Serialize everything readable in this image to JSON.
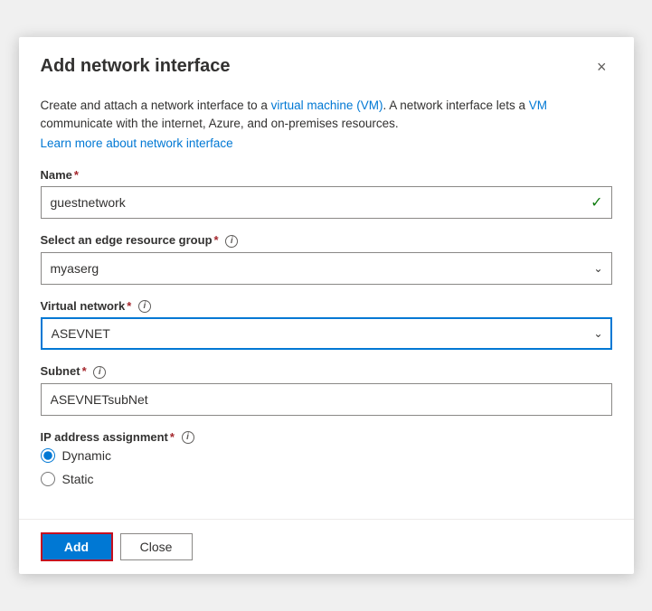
{
  "dialog": {
    "title": "Add network interface",
    "close_label": "×"
  },
  "description": {
    "text1": "Create and attach a network interface to a virtual machine (VM). A network interface lets a VM communicate with the internet, Azure, and on-premises resources.",
    "link_text": "Learn more about network interface"
  },
  "form": {
    "name_label": "Name",
    "name_required": "*",
    "name_value": "guestnetwork",
    "edge_rg_label": "Select an edge resource group",
    "edge_rg_required": "*",
    "edge_rg_value": "myaserg",
    "virtual_network_label": "Virtual network",
    "virtual_network_required": "*",
    "virtual_network_value": "ASEVNET",
    "subnet_label": "Subnet",
    "subnet_required": "*",
    "subnet_value": "ASEVNETsubNet",
    "ip_label": "IP address assignment",
    "ip_required": "*",
    "ip_options": [
      {
        "value": "dynamic",
        "label": "Dynamic",
        "checked": true
      },
      {
        "value": "static",
        "label": "Static",
        "checked": false
      }
    ]
  },
  "footer": {
    "add_label": "Add",
    "close_label": "Close"
  }
}
